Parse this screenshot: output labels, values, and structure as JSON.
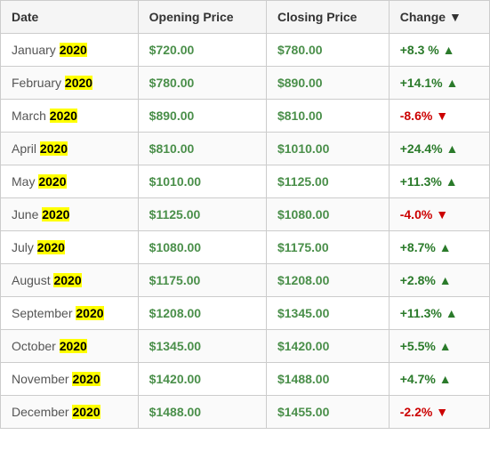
{
  "table": {
    "headers": [
      "Date",
      "Opening Price",
      "Closing Price",
      "Change ▼"
    ],
    "rows": [
      {
        "month": "January",
        "year": "2020",
        "opening": "$720.00",
        "closing": "$780.00",
        "change": "+8.3 %",
        "direction": "up"
      },
      {
        "month": "February",
        "year": "2020",
        "opening": "$780.00",
        "closing": "$890.00",
        "change": "+14.1%",
        "direction": "up"
      },
      {
        "month": "March",
        "year": "2020",
        "opening": "$890.00",
        "closing": "$810.00",
        "change": "-8.6%",
        "direction": "down"
      },
      {
        "month": "April",
        "year": "2020",
        "opening": "$810.00",
        "closing": "$1010.00",
        "change": "+24.4%",
        "direction": "up"
      },
      {
        "month": "May",
        "year": "2020",
        "opening": "$1010.00",
        "closing": "$1125.00",
        "change": "+11.3%",
        "direction": "up"
      },
      {
        "month": "June",
        "year": "2020",
        "opening": "$1125.00",
        "closing": "$1080.00",
        "change": "-4.0%",
        "direction": "down"
      },
      {
        "month": "July",
        "year": "2020",
        "opening": "$1080.00",
        "closing": "$1175.00",
        "change": "+8.7%",
        "direction": "up"
      },
      {
        "month": "August",
        "year": "2020",
        "opening": "$1175.00",
        "closing": "$1208.00",
        "change": "+2.8%",
        "direction": "up"
      },
      {
        "month": "September",
        "year": "2020",
        "opening": "$1208.00",
        "closing": "$1345.00",
        "change": "+11.3%",
        "direction": "up"
      },
      {
        "month": "October",
        "year": "2020",
        "opening": "$1345.00",
        "closing": "$1420.00",
        "change": "+5.5%",
        "direction": "up"
      },
      {
        "month": "November",
        "year": "2020",
        "opening": "$1420.00",
        "closing": "$1488.00",
        "change": "+4.7%",
        "direction": "up"
      },
      {
        "month": "December",
        "year": "2020",
        "opening": "$1488.00",
        "closing": "$1455.00",
        "change": "-2.2%",
        "direction": "down"
      }
    ]
  }
}
